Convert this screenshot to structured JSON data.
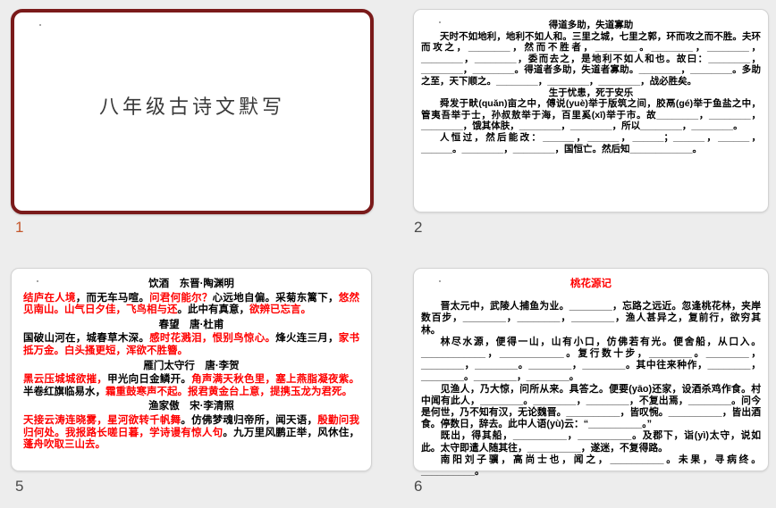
{
  "colors": {
    "background": "#EDEDED",
    "slide1_frame": "#7A1A1A",
    "highlight_red": "#FF0000",
    "selected_number": "#C4562B",
    "number_gray": "#4A4A4A"
  },
  "slides": {
    "s1": {
      "number": "1",
      "title": "八年级古诗文默写"
    },
    "s2": {
      "number": "2",
      "sections": [
        {
          "title": "得道多助，失道寡助",
          "paragraphs": [
            "天时不如地利，地利不如人和。三里之城，七里之郭，环而攻之而不胜。夫环而攻之，________，然而不胜者，________。________，________，________，________，委而去之，是地利不如人和也。故曰：________，________，________。得道者多助，失道者寡助。________，________。多助之至，天下顺之。________，________，________，战必胜矣。"
          ]
        },
        {
          "title": "生于忧患，死于安乐",
          "paragraphs": [
            "舜发于畎(quǎn)亩之中，傅说(yuè)举于版筑之间，胶鬲(gé)举于鱼盐之中，管夷吾举于士，孙叔敖举于海，百里奚(xī)举于市。故________，________，________，饿其体肤，________，________，所以________，________。",
            "人恒过，然后能改：______，______，______；______，______，______。________，________，国恒亡。然后知____________。"
          ]
        }
      ]
    },
    "s5": {
      "number": "5",
      "poems": [
        {
          "title": "饮酒　东晋·陶渊明",
          "segments": [
            {
              "t": "结庐在人境",
              "red": true
            },
            {
              "t": "，而无车马喧。",
              "red": false
            },
            {
              "t": "问君何能尔？",
              "red": true
            },
            {
              "t": "心远地自偏。采菊东篱下，",
              "red": false
            },
            {
              "t": "悠然见南山。山气日夕佳，飞鸟相与还",
              "red": true
            },
            {
              "t": "。此中有真意，",
              "red": false
            },
            {
              "t": "欲辨已忘言。",
              "red": true
            }
          ]
        },
        {
          "title": "春望　唐·杜甫",
          "segments": [
            {
              "t": "国破山河在，城春草木深。",
              "red": false
            },
            {
              "t": "感时花溅泪，恨别鸟惊心。",
              "red": true
            },
            {
              "t": "烽火连三月，",
              "red": false
            },
            {
              "t": "家书抵万金。白头搔更短，浑欲不胜簪。",
              "red": true
            }
          ]
        },
        {
          "title": "雁门太守行　唐·李贺",
          "segments": [
            {
              "t": "黑云压城城欲摧，",
              "red": true
            },
            {
              "t": "甲光向日金鳞开。",
              "red": false
            },
            {
              "t": "角声满天秋色里，塞上燕脂凝夜紫。",
              "red": true
            },
            {
              "t": "半卷红旗临易水，",
              "red": false
            },
            {
              "t": "霜重鼓寒声不起。报君黄金台上意，提携玉龙为君死。",
              "red": true
            }
          ]
        },
        {
          "title": "渔家傲　宋·李清照",
          "segments": [
            {
              "t": "天接云涛连晓雾，星河欲转千帆舞",
              "red": true
            },
            {
              "t": "。仿佛梦魂归帝所，闻天语，",
              "red": false
            },
            {
              "t": "殷勤问我归何处。我报路长嗟日暮，学诗谩有惊人句",
              "red": true
            },
            {
              "t": "。九万里风鹏正举，风休住，",
              "red": false
            },
            {
              "t": "蓬舟吹取三山去。",
              "red": true
            }
          ]
        }
      ]
    },
    "s6": {
      "number": "6",
      "title": "桃花源记",
      "paragraphs": [
        "晋太元中，武陵人捕鱼为业。________，忘路之远近。忽逢桃花林，夹岸数百步，________，________，________，渔人甚异之，复前行，欲穷其林。",
        "林尽水源，便得一山，山有小口，仿佛若有光。便舍船，从口入。____________，____________。复行数十步，________。________，________，________。________，________。其中往来种作，________，________。________，________。",
        "见渔人，乃大惊，问所从来。具答之。便要(yāo)还家，设酒杀鸡作食。村中闻有此人，________。________，________，不复出焉，________。问今是何世，乃不知有汉，无论魏晋。__________，皆叹惋。__________，皆出酒食。停数日，辞去。此中人语(yù)云：“__________。”",
        "既出，得其船，__________，__________。及郡下，诣(yì)太守，说如此。太守即遣人随其往，__________，遂迷，不复得路。",
        "南阳刘子骥，高尚士也，闻之，__________。未果，寻病终。__________。"
      ]
    }
  }
}
